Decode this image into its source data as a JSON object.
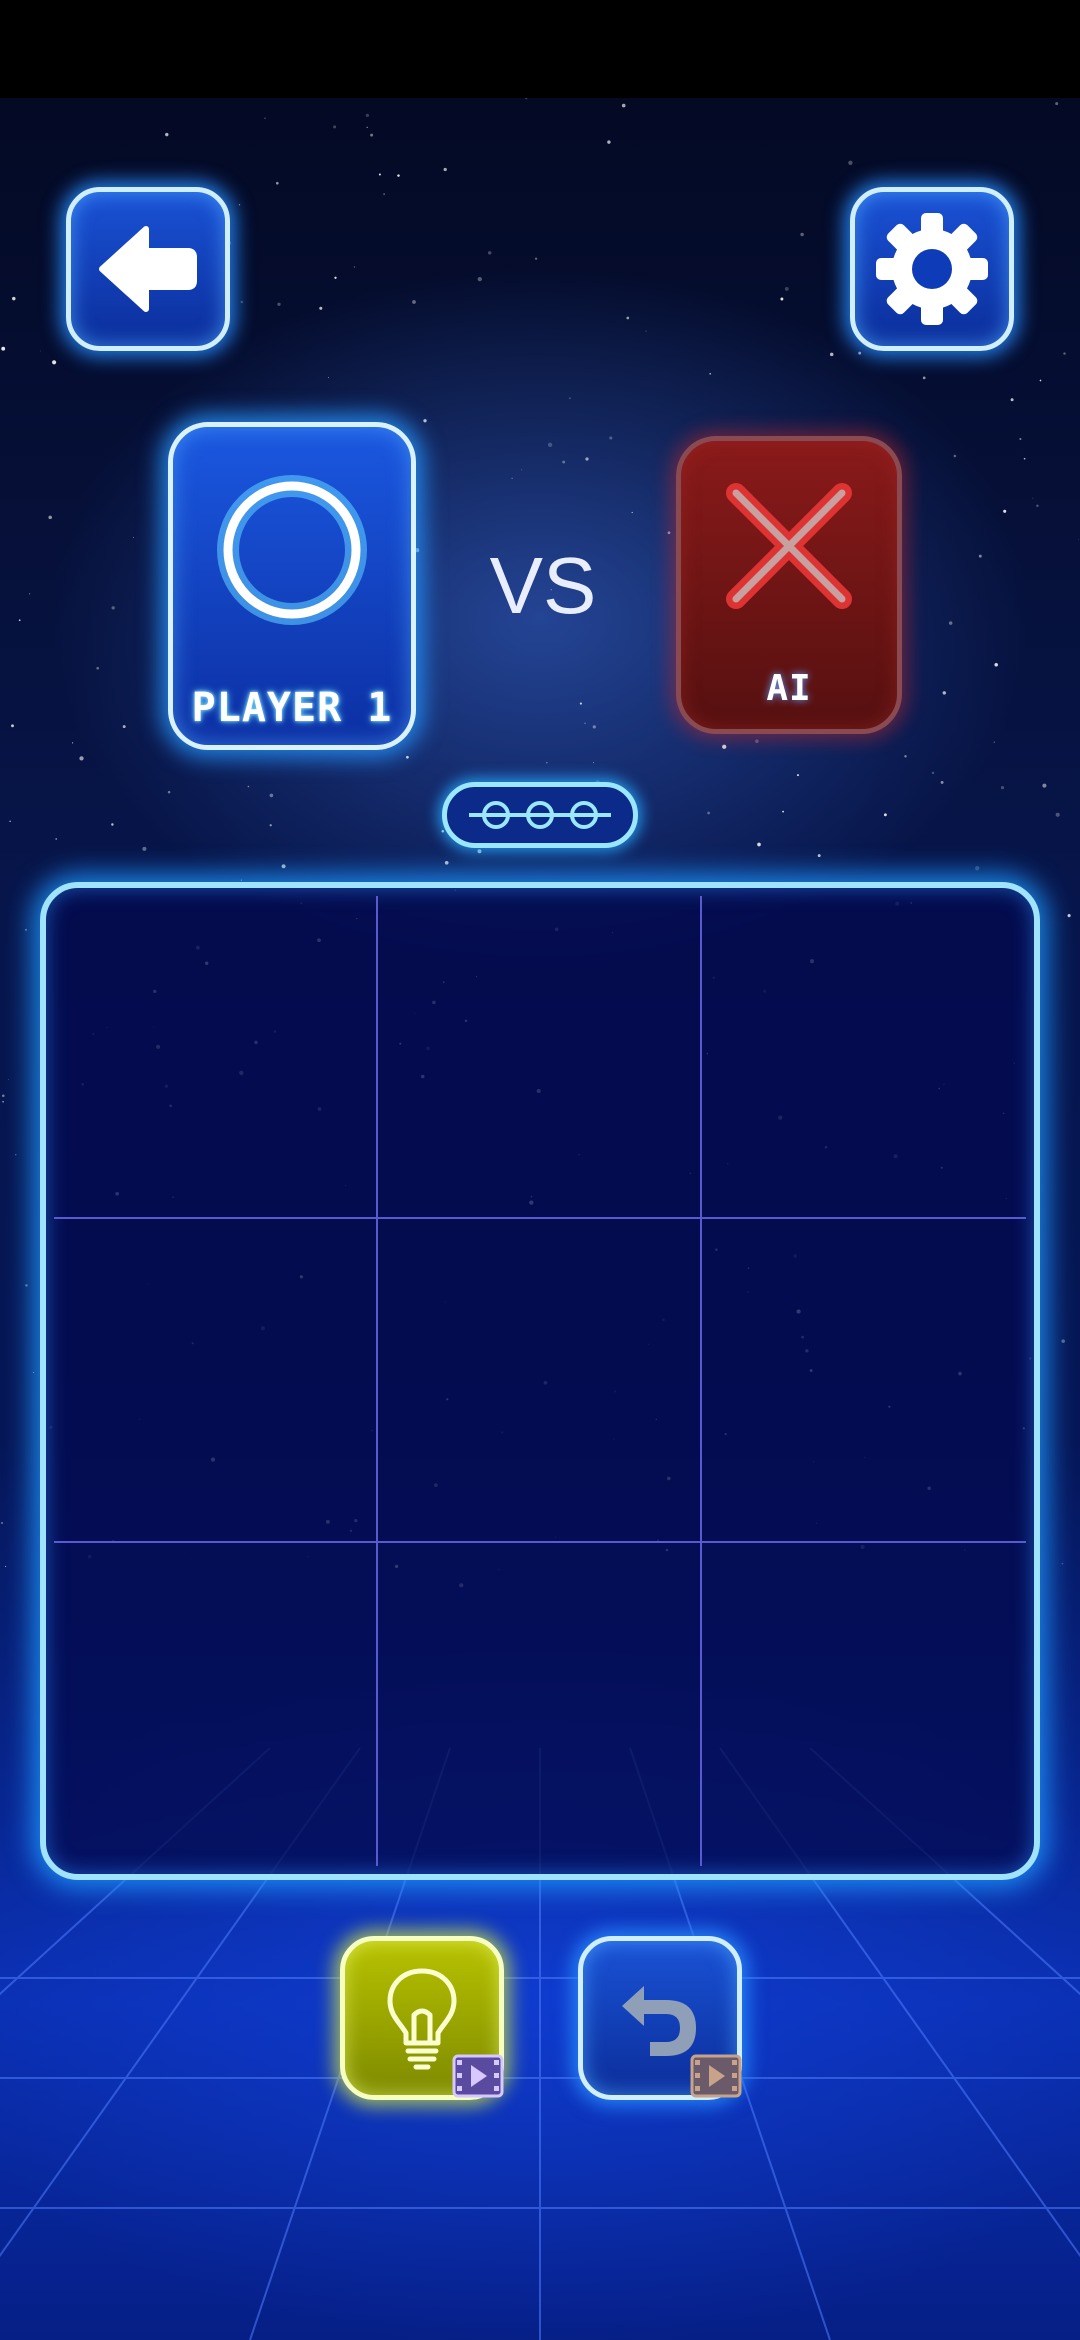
{
  "header": {
    "back_icon": "arrow-left-icon",
    "settings_icon": "gear-icon"
  },
  "players": {
    "player1": {
      "label": "PLAYER 1",
      "symbol": "O",
      "color": "#2fb7ff"
    },
    "opponent": {
      "label": "AI",
      "symbol": "X",
      "color": "#c91a1a"
    },
    "vs_text": "VS"
  },
  "round_progress": {
    "total": 3,
    "won": 0
  },
  "board": {
    "cells": [
      "",
      "",
      "",
      "",
      "",
      "",
      "",
      "",
      ""
    ]
  },
  "actions": {
    "hint_icon": "lightbulb-icon",
    "undo_icon": "undo-icon",
    "badge_icon": "video-ad-icon"
  },
  "colors": {
    "neon_blue": "#9fe3ff",
    "hint_yellow": "#b7c200",
    "ai_red": "#8a1a1a"
  }
}
